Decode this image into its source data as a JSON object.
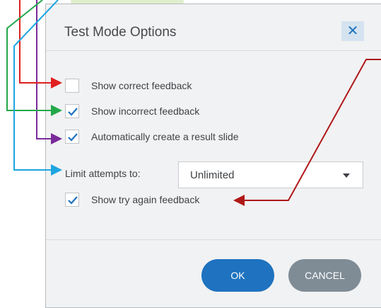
{
  "dialog": {
    "title": "Test Mode Options",
    "close_glyph": "✕",
    "options": [
      {
        "label": "Show correct feedback",
        "checked": false
      },
      {
        "label": "Show incorrect feedback",
        "checked": true
      },
      {
        "label": "Automatically create a result slide",
        "checked": true
      }
    ],
    "limit_label": "Limit attempts to:",
    "limit_value": "Unlimited",
    "try_again": {
      "label": "Show try again feedback",
      "checked": true
    },
    "ok_label": "OK",
    "cancel_label": "CANCEL"
  },
  "colors": {
    "check": "#1e72bf",
    "arrow_red": "#e02020",
    "arrow_green": "#22a84a",
    "arrow_purple": "#7a2a9a",
    "arrow_blue": "#1ea5e0",
    "arrow_darkred": "#b01818"
  }
}
